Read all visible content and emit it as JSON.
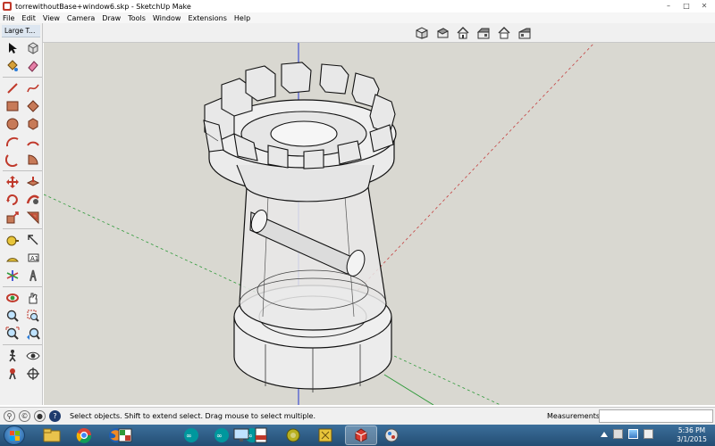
{
  "window": {
    "title": "torrewithoutBase+window6.skp - SketchUp Make",
    "controls": [
      "minimize",
      "maximize",
      "close"
    ]
  },
  "menubar": {
    "items": [
      "File",
      "Edit",
      "View",
      "Camera",
      "Draw",
      "Tools",
      "Window",
      "Extensions",
      "Help"
    ]
  },
  "views_toolbar": {
    "buttons": [
      "iso-view-icon",
      "top-view-icon",
      "front-view-icon",
      "right-view-icon",
      "back-view-icon",
      "left-view-icon"
    ]
  },
  "palette": {
    "title": "Large T...",
    "tools": [
      "select-icon",
      "component-icon",
      "paint-bucket-icon",
      "eraser-icon",
      "line-icon",
      "freehand-icon",
      "rectangle-icon",
      "rotated-rectangle-icon",
      "circle-icon",
      "polygon-icon",
      "arc-icon",
      "two-point-arc-icon",
      "three-point-arc-icon",
      "pie-icon",
      "move-icon",
      "push-pull-icon",
      "rotate-icon",
      "follow-me-icon",
      "scale-icon",
      "offset-icon",
      "tape-measure-icon",
      "dimension-icon",
      "protractor-icon",
      "text-icon",
      "axes-icon",
      "3d-text-icon",
      "orbit-icon",
      "pan-icon",
      "zoom-icon",
      "zoom-window-icon",
      "zoom-extents-icon",
      "previous-view-icon",
      "walk-icon",
      "look-around-icon",
      "position-camera-icon",
      "section-plane-icon"
    ]
  },
  "statusbar": {
    "hint": "Select objects. Shift to extend select. Drag mouse to select multiple.",
    "measurements_label": "Measurements",
    "measurements_value": ""
  },
  "taskbar": {
    "apps": [
      "windows-explorer-icon",
      "chrome-icon",
      "firefox-icon",
      "paint-icon",
      "arduino-icon",
      "arduino-icon-2",
      "arduino-icon-3",
      "monitor-icon",
      "pdf-icon",
      "tools-icon",
      "sketchup-icon",
      "sketchup-make-icon",
      "image-viewer-icon"
    ],
    "clock_time": "5:36 PM",
    "clock_date": "3/1/2015"
  },
  "colors": {
    "canvas_bg": "#d9d8d1",
    "axis_blue": "#2436d1",
    "axis_red": "#c44040",
    "axis_green": "#2f9a3a",
    "model_edge": "#111111"
  }
}
